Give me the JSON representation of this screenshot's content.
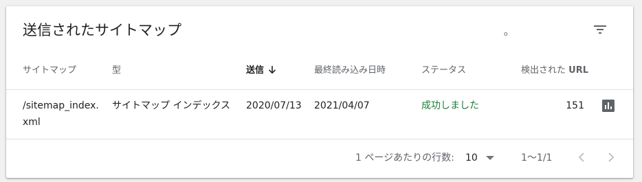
{
  "card": {
    "title": "送信されたサイトマップ",
    "stray_mark": "o",
    "filter_icon": "filter-list-icon"
  },
  "table": {
    "headers": {
      "sitemap": "サイトマップ",
      "type": "型",
      "submitted": "送信",
      "last_read": "最終読み込み日時",
      "status": "ステータス",
      "discovered_prefix": "検出された ",
      "discovered_url": "URL"
    },
    "sort": {
      "column": "submitted",
      "direction": "descending",
      "icon": "arrow-down-icon"
    },
    "rows": [
      {
        "sitemap": "/sitemap_index.xml",
        "type": "サイトマップ インデックス",
        "submitted": "2020/07/13",
        "last_read": "2021/04/07",
        "status": "成功しました",
        "discovered_urls": "151",
        "action_icon": "bar-chart-icon"
      }
    ]
  },
  "pagination": {
    "rows_per_page_label": "1 ページあたりの行数:",
    "rows_per_page": "10",
    "range": "1〜1/1",
    "prev_icon": "chevron-left-icon",
    "next_icon": "chevron-right-icon"
  },
  "colors": {
    "status_success": "#188038",
    "muted_text": "#5f6368",
    "icon": "#5f6368",
    "disabled_icon": "#bdbdbd"
  }
}
